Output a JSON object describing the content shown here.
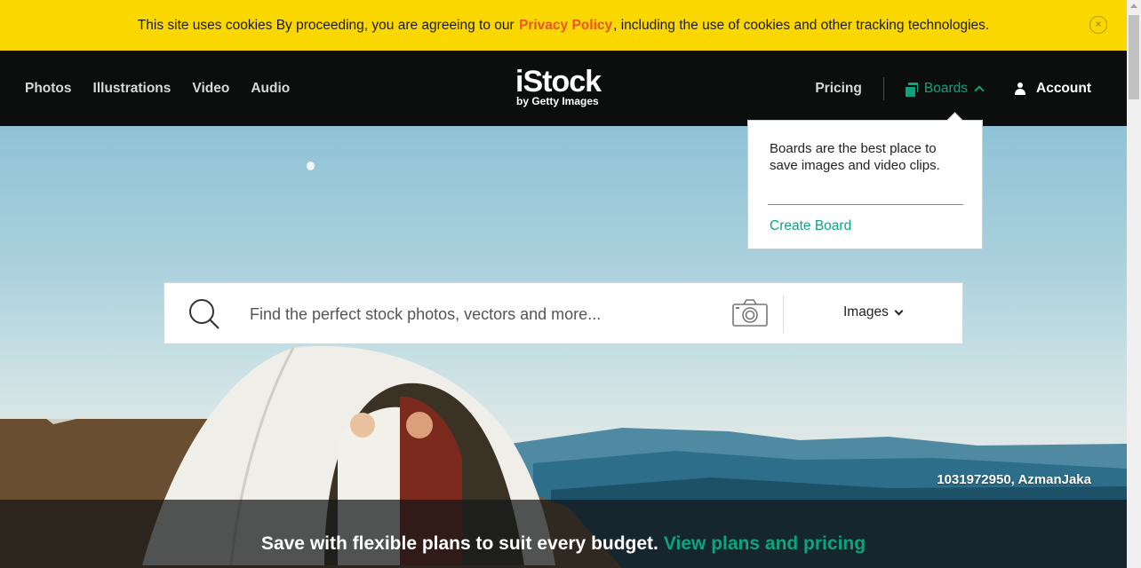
{
  "cookie_banner": {
    "text_before": "This site uses cookies By proceeding, you are agreeing to our",
    "policy_link": "Privacy Policy",
    "text_after": ", including the use of cookies and other tracking technologies.",
    "close_symbol": "×"
  },
  "header": {
    "nav_left": [
      "Photos",
      "Illustrations",
      "Video",
      "Audio"
    ],
    "logo": {
      "brand": "iStock",
      "sub": "by Getty Images"
    },
    "pricing": "Pricing",
    "boards": "Boards",
    "account": "Account"
  },
  "boards_popover": {
    "text": "Boards are the best place to save images and video clips.",
    "create_link": "Create Board"
  },
  "search": {
    "placeholder": "Find the perfect stock photos, vectors and more...",
    "media_type": "Images"
  },
  "hero": {
    "credit": "1031972950, AzmanJaka"
  },
  "promo": {
    "text": "Save with flexible plans to suit every budget.",
    "link": "View plans and pricing"
  },
  "colors": {
    "banner_yellow": "#fbd700",
    "accent_green": "#0ca47c",
    "policy_orange": "#e8552b",
    "header_black": "#0c0d0d"
  },
  "icons": [
    "close-icon",
    "boards-icon",
    "chevron-up-icon",
    "user-icon",
    "search-icon",
    "camera-icon",
    "chevron-down-icon"
  ]
}
